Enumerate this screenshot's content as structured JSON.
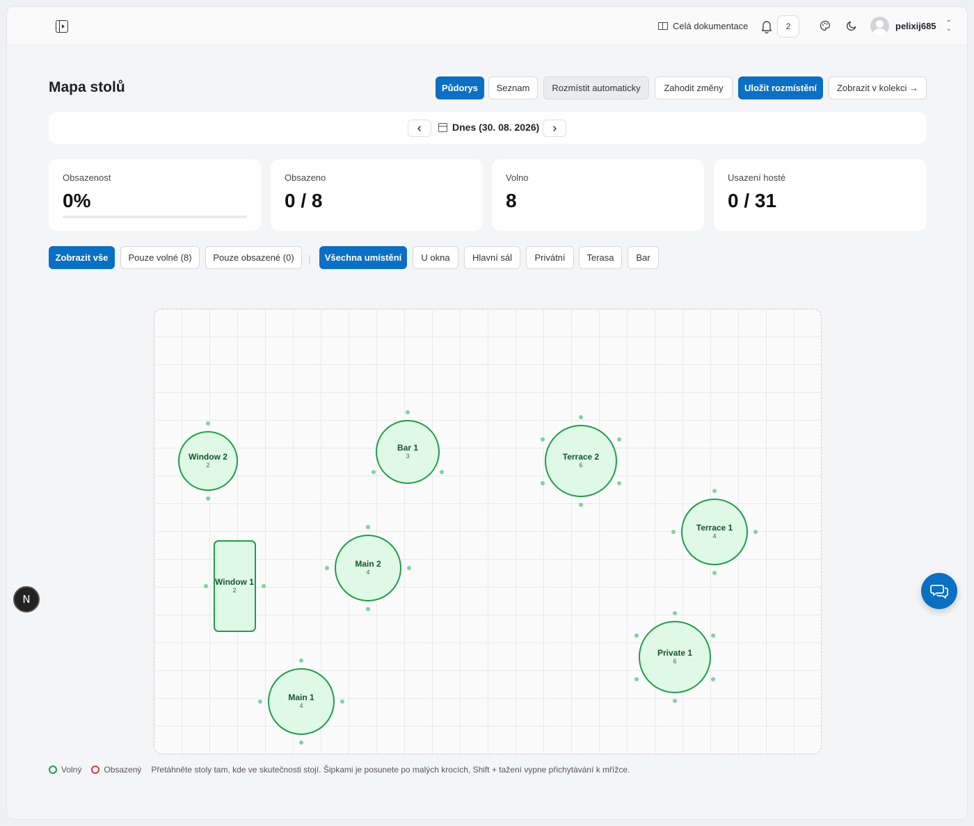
{
  "header": {
    "docs_label": "Celá dokumentace",
    "notification_count": "2",
    "username": "pelixij685"
  },
  "page": {
    "title": "Mapa stolů"
  },
  "toolbar": {
    "floorplan": "Půdorys",
    "list": "Seznam",
    "auto_arrange": "Rozmístit automaticky",
    "discard": "Zahodit změny",
    "save": "Uložit rozmístění",
    "show_in_collection": "Zobrazit v kolekci →"
  },
  "date": {
    "label": "Dnes (30. 08. 2026)"
  },
  "stats": {
    "occupancy": {
      "label": "Obsazenost",
      "value": "0%",
      "fraction": 0
    },
    "occupied": {
      "label": "Obsazeno",
      "value": "0 / 8"
    },
    "free": {
      "label": "Volno",
      "value": "8"
    },
    "guests": {
      "label": "Usazení hosté",
      "value": "0 / 31"
    }
  },
  "filters": {
    "show_all": "Zobrazit vše",
    "only_free": "Pouze volné (8)",
    "only_occupied": "Pouze obsazené (0)",
    "separator": "|",
    "all_locations": "Všechna umístění",
    "window": "U okna",
    "main_hall": "Hlavní sál",
    "private": "Privátní",
    "terrace": "Terasa",
    "bar": "Bar"
  },
  "tables": [
    {
      "name": "Window 2",
      "seats": "2",
      "status": "free"
    },
    {
      "name": "Bar 1",
      "seats": "3",
      "status": "free"
    },
    {
      "name": "Terrace 2",
      "seats": "6",
      "status": "free"
    },
    {
      "name": "Terrace 1",
      "seats": "4",
      "status": "free"
    },
    {
      "name": "Window 1",
      "seats": "2",
      "status": "free"
    },
    {
      "name": "Main 2",
      "seats": "4",
      "status": "free"
    },
    {
      "name": "Private 1",
      "seats": "6",
      "status": "free"
    },
    {
      "name": "Main 1",
      "seats": "4",
      "status": "free"
    }
  ],
  "legend": {
    "free": "Volný",
    "occupied": "Obsazený",
    "hint": "Přetáhněte stoly tam, kde ve skutečnosti stojí. Šipkami je posunete po malých krocích, Shift + tažení vypne přichytávání k mřížce."
  },
  "colors": {
    "accent": "#0b6fc4",
    "free": "#1f9d48",
    "occupied": "#d43c3c",
    "table_fill": "#dff9e6"
  },
  "icons": {
    "sidebar_toggle": "panel-left-icon",
    "bell": "bell-icon",
    "palette": "palette-icon",
    "theme": "moon-icon",
    "chat": "chat-icon",
    "dev": "n-logo-icon"
  }
}
